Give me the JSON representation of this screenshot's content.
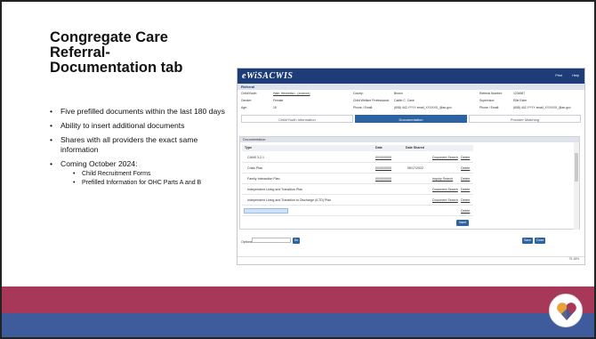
{
  "slide": {
    "title": "Congregate Care Referral- Documentation tab",
    "bullets": [
      "Five prefilled documents within the last 180 days",
      "Ability to insert additional documents",
      "Shares with all providers the exact same information",
      "Coming October 2024:"
    ],
    "sub_bullets": [
      "Child Recruitment Forms",
      "Prefilled Information for OHC Parts A and B"
    ]
  },
  "app": {
    "brand": "eWiSACWIS",
    "header_links": [
      "Print",
      "Help"
    ],
    "section_label": "Referral",
    "info_labels_col1": [
      "Child/Youth:",
      "Gender:",
      "Age:"
    ],
    "info_values_col1": [
      "Hale, Henrietta L. (xxxxxxx)",
      "Female",
      "15"
    ],
    "info_labels_col2": [
      "County:",
      "Child Welfare Professional:",
      "Phone / Email:"
    ],
    "info_values_col2": [
      "Brown",
      "Caitlin C. Cane",
      "(608) 442-YYYY    email_XYXXXX_@an.gov"
    ],
    "info_labels_col3": [
      "Referral Number:",
      "Supervisor:",
      "Phone / Email:"
    ],
    "info_values_col3": [
      "1234567",
      "Ellie Ester",
      "(608) 442-YYYY    email_XYXXXX_@an.gov"
    ],
    "tabs": [
      "Child/Youth Information",
      "Documentation",
      "Provider Matching"
    ],
    "panel_title": "Documentation",
    "columns": [
      "Type",
      "Date",
      "Date Shared"
    ],
    "rows": [
      {
        "type": "CANS 3.2.1",
        "date": "00/00/0000",
        "shared": "",
        "action": "Document Search",
        "del": "Delete"
      },
      {
        "type": "Crisis Plan",
        "date": "00/00/0000",
        "shared": "06/17/2022",
        "action": "",
        "del": "Delete"
      },
      {
        "type": "Family Interaction Plan",
        "date": "00/00/0000",
        "shared": "",
        "action": "Inquiry Search",
        "del": "Delete"
      },
      {
        "type": "Independent Living and Transition Plan",
        "date": "",
        "shared": "",
        "action": "Document Search",
        "del": "Delete"
      },
      {
        "type": "Independent Living and Transition to Discharge (ILTD) Plan",
        "date": "",
        "shared": "",
        "action": "Document Search",
        "del": "Delete"
      },
      {
        "type": "",
        "date": "",
        "shared": "",
        "action": "",
        "del": "Delete"
      }
    ],
    "insert_label": "Insert",
    "options_label": "Options",
    "go_label": "Go",
    "save_label": "Save",
    "close_label": "Close",
    "zoom": "75.18%"
  }
}
